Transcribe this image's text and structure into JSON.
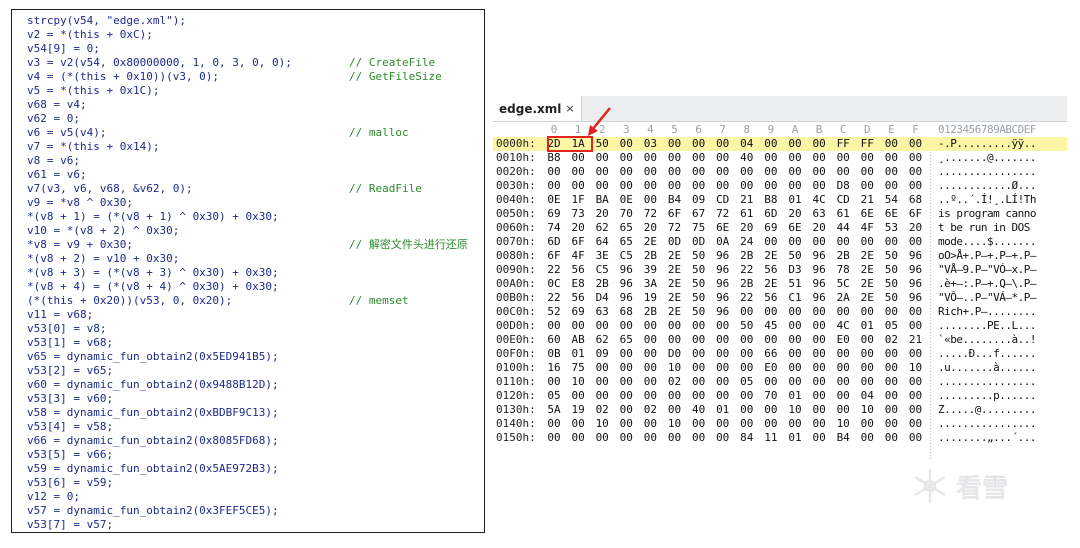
{
  "code_panel": {
    "lines": [
      {
        "code": "strcpy(v54, \"edge.xml\");",
        "comment": ""
      },
      {
        "code": "v2 = *(this + 0xC);",
        "comment": ""
      },
      {
        "code": "v54[9] = 0;",
        "comment": ""
      },
      {
        "code": "v3 = v2(v54, 0x80000000, 1, 0, 3, 0, 0);",
        "comment": "// CreateFile"
      },
      {
        "code": "v4 = (*(this + 0x10))(v3, 0);",
        "comment": "// GetFileSize"
      },
      {
        "code": "v5 = *(this + 0x1C);",
        "comment": ""
      },
      {
        "code": "v68 = v4;",
        "comment": ""
      },
      {
        "code": "v62 = 0;",
        "comment": ""
      },
      {
        "code": "v6 = v5(v4);",
        "comment": "// malloc"
      },
      {
        "code": "v7 = *(this + 0x14);",
        "comment": ""
      },
      {
        "code": "v8 = v6;",
        "comment": ""
      },
      {
        "code": "v61 = v6;",
        "comment": ""
      },
      {
        "code": "v7(v3, v6, v68, &v62, 0);",
        "comment": "// ReadFile"
      },
      {
        "code": "v9 = *v8 ^ 0x30;",
        "comment": ""
      },
      {
        "code": "*(v8 + 1) = (*(v8 + 1) ^ 0x30) + 0x30;",
        "comment": ""
      },
      {
        "code": "v10 = *(v8 + 2) ^ 0x30;",
        "comment": ""
      },
      {
        "code": "*v8 = v9 + 0x30;",
        "comment": "// 解密文件头进行还原"
      },
      {
        "code": "*(v8 + 2) = v10 + 0x30;",
        "comment": ""
      },
      {
        "code": "*(v8 + 3) = (*(v8 + 3) ^ 0x30) + 0x30;",
        "comment": ""
      },
      {
        "code": "*(v8 + 4) = (*(v8 + 4) ^ 0x30) + 0x30;",
        "comment": ""
      },
      {
        "code": "(*(this + 0x20))(v53, 0, 0x20);",
        "comment": "// memset"
      },
      {
        "code": "v11 = v68;",
        "comment": ""
      },
      {
        "code": "v53[0] = v8;",
        "comment": ""
      },
      {
        "code": "v53[1] = v68;",
        "comment": ""
      },
      {
        "code": "v65 = dynamic_fun_obtain2(0x5ED941B5);",
        "comment": ""
      },
      {
        "code": "v53[2] = v65;",
        "comment": ""
      },
      {
        "code": "v60 = dynamic_fun_obtain2(0x9488B12D);",
        "comment": ""
      },
      {
        "code": "v53[3] = v60;",
        "comment": ""
      },
      {
        "code": "v58 = dynamic_fun_obtain2(0xBDBF9C13);",
        "comment": ""
      },
      {
        "code": "v53[4] = v58;",
        "comment": ""
      },
      {
        "code": "v66 = dynamic_fun_obtain2(0x8085FD68);",
        "comment": ""
      },
      {
        "code": "v53[5] = v66;",
        "comment": ""
      },
      {
        "code": "v59 = dynamic_fun_obtain2(0x5AE972B3);",
        "comment": ""
      },
      {
        "code": "v53[6] = v59;",
        "comment": ""
      },
      {
        "code": "v12 = 0;",
        "comment": ""
      },
      {
        "code": "v57 = dynamic_fun_obtain2(0x3FEF5CE5);",
        "comment": ""
      },
      {
        "code": "v53[7] = v57;",
        "comment": ""
      }
    ]
  },
  "hex_editor": {
    "tab": {
      "label": "edge.xml",
      "close": "×"
    },
    "column_headers": [
      "0",
      "1",
      "2",
      "3",
      "4",
      "5",
      "6",
      "7",
      "8",
      "9",
      "A",
      "B",
      "C",
      "D",
      "E",
      "F"
    ],
    "ascii_header": "0123456789ABCDEF",
    "rows": [
      {
        "offset": "0000h:",
        "bytes": [
          "2D",
          "1A",
          "50",
          "00",
          "03",
          "00",
          "00",
          "00",
          "04",
          "00",
          "00",
          "00",
          "FF",
          "FF",
          "00",
          "00"
        ],
        "ascii": "-.P.........ÿÿ.."
      },
      {
        "offset": "0010h:",
        "bytes": [
          "B8",
          "00",
          "00",
          "00",
          "00",
          "00",
          "00",
          "00",
          "40",
          "00",
          "00",
          "00",
          "00",
          "00",
          "00",
          "00"
        ],
        "ascii": "¸.......@......."
      },
      {
        "offset": "0020h:",
        "bytes": [
          "00",
          "00",
          "00",
          "00",
          "00",
          "00",
          "00",
          "00",
          "00",
          "00",
          "00",
          "00",
          "00",
          "00",
          "00",
          "00"
        ],
        "ascii": "................"
      },
      {
        "offset": "0030h:",
        "bytes": [
          "00",
          "00",
          "00",
          "00",
          "00",
          "00",
          "00",
          "00",
          "00",
          "00",
          "00",
          "00",
          "D8",
          "00",
          "00",
          "00"
        ],
        "ascii": "............Ø..."
      },
      {
        "offset": "0040h:",
        "bytes": [
          "0E",
          "1F",
          "BA",
          "0E",
          "00",
          "B4",
          "09",
          "CD",
          "21",
          "B8",
          "01",
          "4C",
          "CD",
          "21",
          "54",
          "68"
        ],
        "ascii": "..º..´.Í!¸.LÍ!Th"
      },
      {
        "offset": "0050h:",
        "bytes": [
          "69",
          "73",
          "20",
          "70",
          "72",
          "6F",
          "67",
          "72",
          "61",
          "6D",
          "20",
          "63",
          "61",
          "6E",
          "6E",
          "6F"
        ],
        "ascii": "is program canno"
      },
      {
        "offset": "0060h:",
        "bytes": [
          "74",
          "20",
          "62",
          "65",
          "20",
          "72",
          "75",
          "6E",
          "20",
          "69",
          "6E",
          "20",
          "44",
          "4F",
          "53",
          "20"
        ],
        "ascii": "t be run in DOS "
      },
      {
        "offset": "0070h:",
        "bytes": [
          "6D",
          "6F",
          "64",
          "65",
          "2E",
          "0D",
          "0D",
          "0A",
          "24",
          "00",
          "00",
          "00",
          "00",
          "00",
          "00",
          "00"
        ],
        "ascii": "mode....$......."
      },
      {
        "offset": "0080h:",
        "bytes": [
          "6F",
          "4F",
          "3E",
          "C5",
          "2B",
          "2E",
          "50",
          "96",
          "2B",
          "2E",
          "50",
          "96",
          "2B",
          "2E",
          "50",
          "96"
        ],
        "ascii": "oO>Å+.P–+.P–+.P–"
      },
      {
        "offset": "0090h:",
        "bytes": [
          "22",
          "56",
          "C5",
          "96",
          "39",
          "2E",
          "50",
          "96",
          "22",
          "56",
          "D3",
          "96",
          "78",
          "2E",
          "50",
          "96"
        ],
        "ascii": "\"VÅ–9.P–\"VÓ–x.P–"
      },
      {
        "offset": "00A0h:",
        "bytes": [
          "0C",
          "E8",
          "2B",
          "96",
          "3A",
          "2E",
          "50",
          "96",
          "2B",
          "2E",
          "51",
          "96",
          "5C",
          "2E",
          "50",
          "96"
        ],
        "ascii": ".è+–:.P–+.Q–\\.P–"
      },
      {
        "offset": "00B0h:",
        "bytes": [
          "22",
          "56",
          "D4",
          "96",
          "19",
          "2E",
          "50",
          "96",
          "22",
          "56",
          "C1",
          "96",
          "2A",
          "2E",
          "50",
          "96"
        ],
        "ascii": "\"VÔ–..P–\"VÁ–*.P–"
      },
      {
        "offset": "00C0h:",
        "bytes": [
          "52",
          "69",
          "63",
          "68",
          "2B",
          "2E",
          "50",
          "96",
          "00",
          "00",
          "00",
          "00",
          "00",
          "00",
          "00",
          "00"
        ],
        "ascii": "Rich+.P–........"
      },
      {
        "offset": "00D0h:",
        "bytes": [
          "00",
          "00",
          "00",
          "00",
          "00",
          "00",
          "00",
          "00",
          "50",
          "45",
          "00",
          "00",
          "4C",
          "01",
          "05",
          "00"
        ],
        "ascii": "........PE..L..."
      },
      {
        "offset": "00E0h:",
        "bytes": [
          "60",
          "AB",
          "62",
          "65",
          "00",
          "00",
          "00",
          "00",
          "00",
          "00",
          "00",
          "00",
          "E0",
          "00",
          "02",
          "21"
        ],
        "ascii": "`«be........à..!"
      },
      {
        "offset": "00F0h:",
        "bytes": [
          "0B",
          "01",
          "09",
          "00",
          "00",
          "D0",
          "00",
          "00",
          "00",
          "66",
          "00",
          "00",
          "00",
          "00",
          "00",
          "00"
        ],
        "ascii": ".....Ð...f......"
      },
      {
        "offset": "0100h:",
        "bytes": [
          "16",
          "75",
          "00",
          "00",
          "00",
          "10",
          "00",
          "00",
          "00",
          "E0",
          "00",
          "00",
          "00",
          "00",
          "00",
          "10"
        ],
        "ascii": ".u.......à......"
      },
      {
        "offset": "0110h:",
        "bytes": [
          "00",
          "10",
          "00",
          "00",
          "00",
          "02",
          "00",
          "00",
          "05",
          "00",
          "00",
          "00",
          "00",
          "00",
          "00",
          "00"
        ],
        "ascii": "................"
      },
      {
        "offset": "0120h:",
        "bytes": [
          "05",
          "00",
          "00",
          "00",
          "00",
          "00",
          "00",
          "00",
          "00",
          "70",
          "01",
          "00",
          "00",
          "04",
          "00",
          "00"
        ],
        "ascii": ".........p......"
      },
      {
        "offset": "0130h:",
        "bytes": [
          "5A",
          "19",
          "02",
          "00",
          "02",
          "00",
          "40",
          "01",
          "00",
          "00",
          "10",
          "00",
          "00",
          "10",
          "00",
          "00"
        ],
        "ascii": "Z.....@........."
      },
      {
        "offset": "0140h:",
        "bytes": [
          "00",
          "00",
          "10",
          "00",
          "00",
          "10",
          "00",
          "00",
          "00",
          "00",
          "00",
          "00",
          "10",
          "00",
          "00",
          "00"
        ],
        "ascii": "................"
      },
      {
        "offset": "0150h:",
        "bytes": [
          "00",
          "00",
          "00",
          "00",
          "00",
          "00",
          "00",
          "00",
          "84",
          "11",
          "01",
          "00",
          "B4",
          "00",
          "00",
          "00"
        ],
        "ascii": "........„...´..."
      }
    ]
  },
  "watermark": {
    "text": "看雪",
    "icon": "snowflake-logo-icon"
  }
}
